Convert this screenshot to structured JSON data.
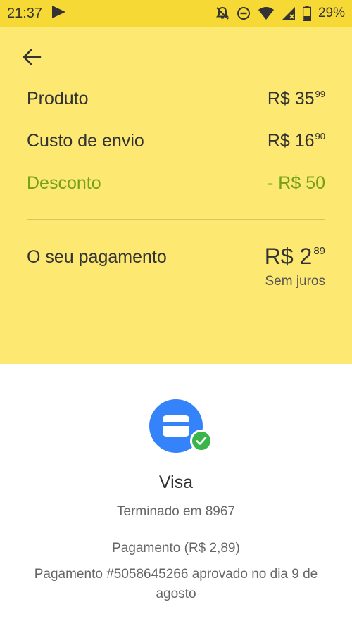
{
  "status_bar": {
    "time": "21:37",
    "battery": "29%",
    "icons": [
      "play-icon",
      "notifications-off-icon",
      "do-not-disturb-icon",
      "wifi-icon",
      "signal-icon",
      "battery-icon"
    ]
  },
  "summary": {
    "back_icon": "arrow-left-icon",
    "rows": [
      {
        "label": "Produto",
        "amount_main": "R$ 35",
        "amount_cents": "99"
      },
      {
        "label": "Custo de envio",
        "amount_main": "R$ 16",
        "amount_cents": "90"
      },
      {
        "label": "Desconto",
        "amount_main": "- R$ 50",
        "amount_cents": ""
      }
    ],
    "discount_color": "#75a017",
    "payment": {
      "label": "O seu pagamento",
      "amount_main": "R$ 2",
      "amount_cents": "89",
      "note": "Sem juros"
    },
    "background_color": "#fde872"
  },
  "payment_method": {
    "icon": "credit-card-icon",
    "badge_icon": "check-icon",
    "name": "Visa",
    "ending": "Terminado em 8967",
    "payment_line": "Pagamento (R$ 2,89)",
    "approved_line": "Pagamento #5058645266 aprovado no dia 9 de agosto",
    "accent_color": "#3483fa",
    "badge_color": "#39b54a"
  }
}
